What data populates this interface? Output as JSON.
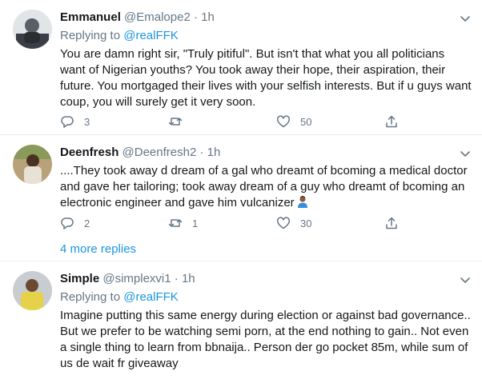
{
  "tweets": [
    {
      "name": "Emmanuel",
      "handle": "@Emalope2",
      "dot": "·",
      "time": "1h",
      "replying_prefix": "Replying to",
      "replying_to": "@realFFK",
      "text": "You are damn right sir,  \"Truly pitiful\". But isn't that what you all politicians want of Nigerian youths? You took away their hope, their aspiration, their future. You mortgaged their lives with your selfish interests. But if u guys want coup, you will surely get it very soon.",
      "replies": "3",
      "retweets": "",
      "likes": "50"
    },
    {
      "name": "Deenfresh",
      "handle": "@Deenfresh2",
      "dot": "·",
      "time": "1h",
      "text": "....They took away d dream of a gal who dreamt of bcoming a medical doctor and gave her tailoring; took away dream of a guy who dreamt of bcoming an electronic engineer and gave him vulcanizer",
      "emoji": "person-gesturing-emoji",
      "replies": "2",
      "retweets": "1",
      "likes": "30"
    },
    {
      "name": "Simple",
      "handle": "@simplexvi1",
      "dot": "·",
      "time": "1h",
      "replying_prefix": "Replying to",
      "replying_to": "@realFFK",
      "text": "Imagine putting this same energy during election or against bad governance.. But we prefer to be watching semi porn, at the end nothing to gain.. Not even a single thing to learn from bbnaija.. Person der go pocket 85m, while sum of us de wait fr giveaway"
    }
  ],
  "more_replies": "4 more replies",
  "colors": {
    "text": "#14171a",
    "secondary": "#657786",
    "link": "#1b95e0",
    "divider": "#e6ecf0"
  },
  "icons": [
    "reply-icon",
    "retweet-icon",
    "like-icon",
    "share-icon",
    "caret-down-icon"
  ]
}
